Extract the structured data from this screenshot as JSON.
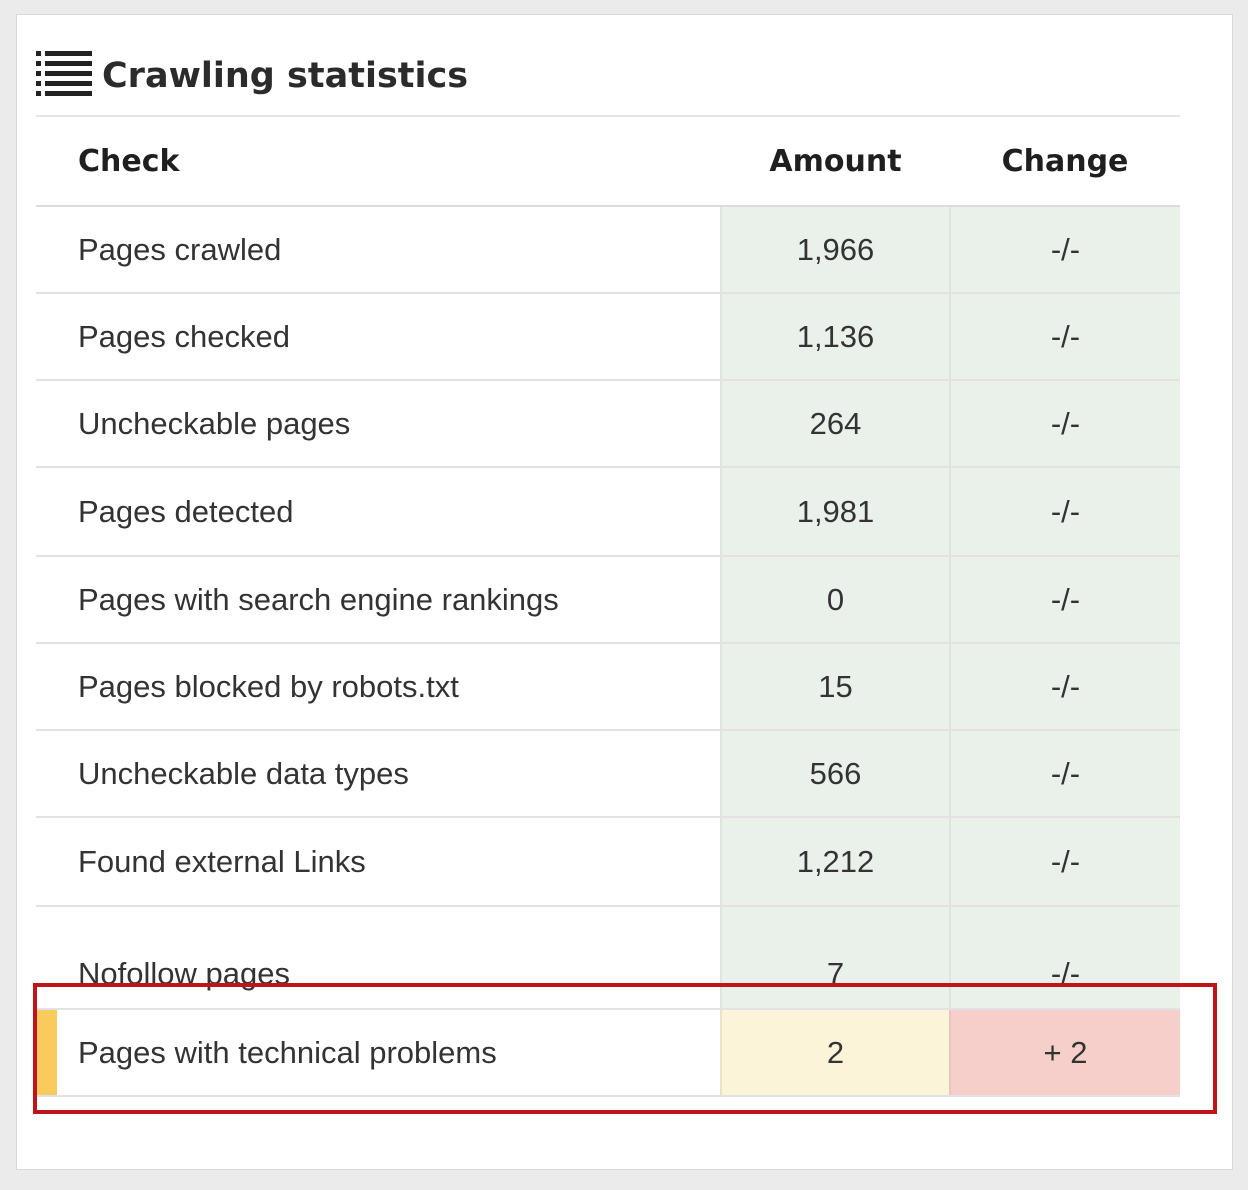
{
  "header": {
    "icon": "list-icon",
    "title": "Crawling statistics"
  },
  "table": {
    "columns": [
      "Check",
      "Amount",
      "Change"
    ],
    "rows": [
      {
        "check": "Pages crawled",
        "amount": "1,966",
        "change": "-/-"
      },
      {
        "check": "Pages checked",
        "amount": "1,136",
        "change": "-/-"
      },
      {
        "check": "Uncheckable pages",
        "amount": "264",
        "change": "-/-"
      },
      {
        "check": "Pages detected",
        "amount": "1,981",
        "change": "-/-"
      },
      {
        "check": "Pages with search engine rankings",
        "amount": "0",
        "change": "-/-"
      },
      {
        "check": "Pages blocked by robots.txt",
        "amount": "15",
        "change": "-/-"
      },
      {
        "check": "Uncheckable data types",
        "amount": "566",
        "change": "-/-"
      },
      {
        "check": "Found external Links",
        "amount": "1,212",
        "change": "-/-"
      },
      {
        "check": "Nofollow pages",
        "amount": "7",
        "change": "-/-"
      },
      {
        "check": "Pages with technical problems",
        "amount": "2",
        "change": "+ 2"
      }
    ]
  },
  "colors": {
    "ok_cell": "#eaf1ea",
    "warn_amount": "#fcf4d9",
    "warn_change": "#f6cfcb",
    "warn_stripe": "#f9cb5c",
    "highlight": "#c0141b"
  }
}
